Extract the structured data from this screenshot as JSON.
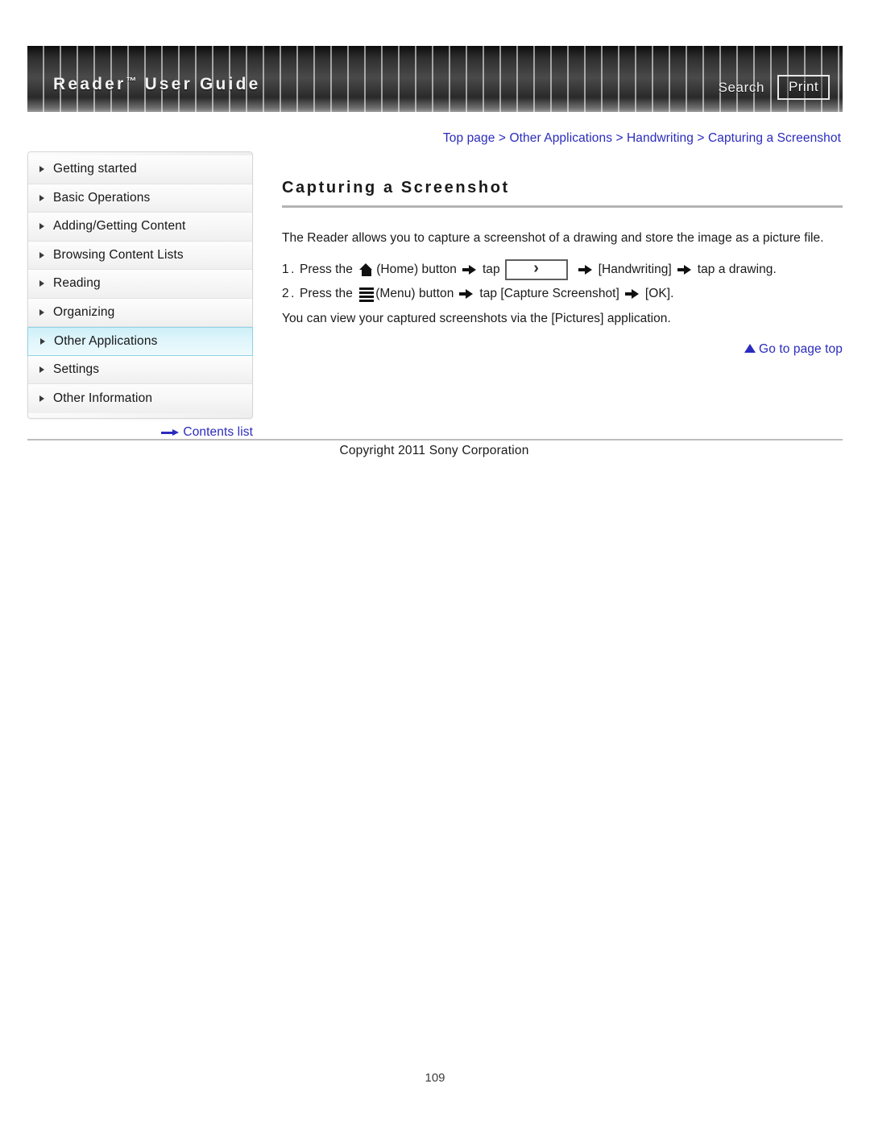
{
  "header": {
    "title": "Reader",
    "title_tm": "™",
    "title_suffix": " User Guide",
    "search_label": "Search",
    "print_label": "Print"
  },
  "breadcrumb": {
    "separator": " > ",
    "items": [
      "Top page",
      "Other Applications",
      "Handwriting",
      "Capturing a Screenshot"
    ]
  },
  "sidebar": {
    "items": [
      {
        "label": "Getting started",
        "active": false
      },
      {
        "label": "Basic Operations",
        "active": false
      },
      {
        "label": "Adding/Getting Content",
        "active": false
      },
      {
        "label": "Browsing Content Lists",
        "active": false
      },
      {
        "label": "Reading",
        "active": false
      },
      {
        "label": "Organizing",
        "active": false
      },
      {
        "label": "Other Applications",
        "active": true
      },
      {
        "label": "Settings",
        "active": false
      },
      {
        "label": "Other Information",
        "active": false
      }
    ],
    "contents_list_label": "Contents list"
  },
  "main": {
    "title": "Capturing a Screenshot",
    "intro": "The Reader allows you to capture a screenshot of a drawing and store the image as a picture file.",
    "step1": {
      "number": "1.",
      "part1": "Press the ",
      "home_label": "(Home) button",
      "part2": "tap",
      "part3": "[Handwriting]",
      "part4": "tap a drawing."
    },
    "step2": {
      "number": "2.",
      "part1": "Press the ",
      "menu_label": "(Menu) button",
      "part2": "tap [Capture Screenshot]",
      "part3": "[OK]."
    },
    "note": "You can view your captured screenshots via the [Pictures] application.",
    "go_to_top_label": "Go to page top"
  },
  "footer": {
    "copyright": "Copyright 2011 Sony Corporation",
    "page_number": "109"
  }
}
